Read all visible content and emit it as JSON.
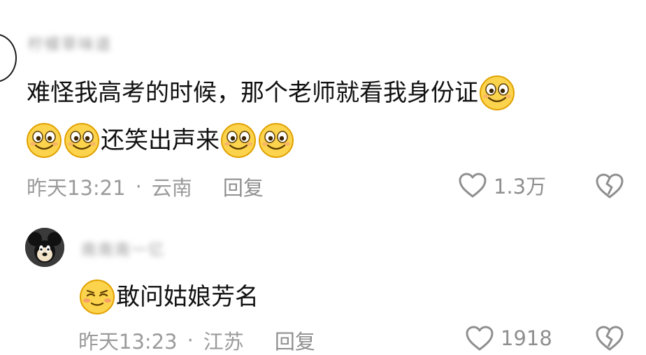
{
  "comment": {
    "username": "柠檬草味道",
    "text_line1": "难怪我高考的时候，那个老师就看我身份证",
    "text_line2": "还笑出声来",
    "time": "昨天13:21",
    "separator": "·",
    "location": "云南",
    "reply_label": "回复",
    "like_count": "1.3万",
    "emoji": "smile-emoji"
  },
  "reply": {
    "username": "南南南一亿",
    "text": "敢问姑娘芳名",
    "time": "昨天13:23",
    "separator": "·",
    "location": "江苏",
    "reply_label": "回复",
    "like_count": "1918",
    "emoji": "shy-smile-emoji"
  },
  "icons": {
    "like": "heart-outline-icon",
    "dislike": "broken-heart-icon"
  },
  "colors": {
    "text": "#111111",
    "meta": "#9b9b9b",
    "emoji_face": "#fcd34d",
    "emoji_outline": "#e0a100"
  }
}
